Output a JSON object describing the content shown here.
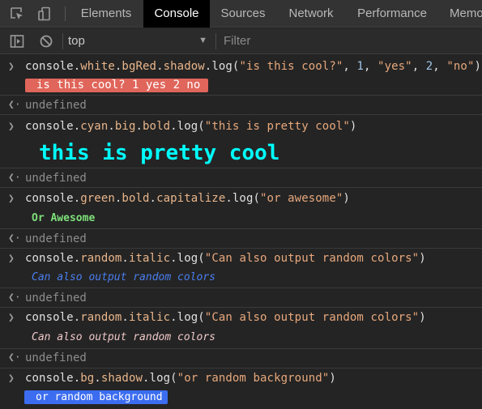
{
  "tabs": [
    {
      "label": "Elements"
    },
    {
      "label": "Console"
    },
    {
      "label": "Sources"
    },
    {
      "label": "Network"
    },
    {
      "label": "Performance"
    },
    {
      "label": "Memo"
    }
  ],
  "toolbar": {
    "context": "top",
    "filter_placeholder": "Filter"
  },
  "icons": {
    "inspect": "inspect-element-icon",
    "device": "device-toolbar-icon",
    "sidebar": "show-sidebar-icon",
    "clear": "clear-console-icon"
  },
  "console": {
    "return_value": "undefined",
    "entries": [
      {
        "code": {
          "obj": "console",
          "d1": ".",
          "p1": "white",
          "d2": ".",
          "p2": "bgRed",
          "d3": ".",
          "p3": "shadow",
          "d4": ".",
          "fn": "log",
          "open": "(",
          "a1": "\"is this cool?\"",
          "c1": ", ",
          "a2": "1",
          "c2": ", ",
          "a3": "\"yes\"",
          "c3": ", ",
          "a4": "2",
          "c4": ", ",
          "a5": "\"no\"",
          "close": ")"
        },
        "output": "is this cool? 1 yes 2 no"
      },
      {
        "code": {
          "obj": "console",
          "d1": ".",
          "p1": "cyan",
          "d2": ".",
          "p2": "big",
          "d3": ".",
          "p3": "bold",
          "d4": ".",
          "fn": "log",
          "open": "(",
          "a1": "\"this is pretty cool\"",
          "close": ")"
        },
        "output": "this is pretty cool"
      },
      {
        "code": {
          "obj": "console",
          "d1": ".",
          "p1": "green",
          "d2": ".",
          "p2": "bold",
          "d3": ".",
          "p3": "capitalize",
          "d4": ".",
          "fn": "log",
          "open": "(",
          "a1": "\"or awesome\"",
          "close": ")"
        },
        "output": "Or Awesome"
      },
      {
        "code": {
          "obj": "console",
          "d1": ".",
          "p1": "random",
          "d2": ".",
          "p2": "italic",
          "d3": ".",
          "fn": "log",
          "open": "(",
          "a1": "\"Can also output random colors\"",
          "close": ")"
        },
        "output": "Can also output random colors"
      },
      {
        "code": {
          "obj": "console",
          "d1": ".",
          "p1": "random",
          "d2": ".",
          "p2": "italic",
          "d3": ".",
          "fn": "log",
          "open": "(",
          "a1": "\"Can also output random colors\"",
          "close": ")"
        },
        "output": "Can also output random colors"
      },
      {
        "code": {
          "obj": "console",
          "d1": ".",
          "p1": "bg",
          "d2": ".",
          "p2": "shadow",
          "d3": ".",
          "fn": "log",
          "open": "(",
          "a1": "\"or random background\"",
          "close": ")"
        },
        "output": "or random background"
      }
    ]
  },
  "colors": {
    "bg_red": "#e0655a",
    "cyan": "#00ffff",
    "green": "#7ee07a",
    "random_blue": "#4a7ff0",
    "random_pink": "#f0c8c8",
    "bg_blue": "#3c6df0"
  }
}
